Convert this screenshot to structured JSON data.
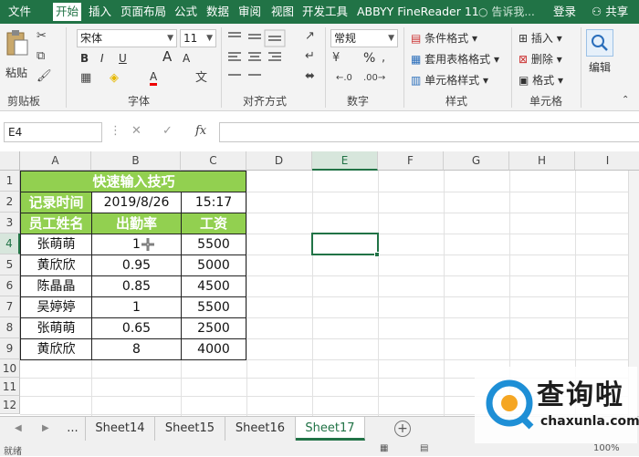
{
  "menubar": {
    "items": [
      "文件",
      "开始",
      "插入",
      "页面布局",
      "公式",
      "数据",
      "审阅",
      "视图",
      "开发工具",
      "ABBYY FineReader 11"
    ],
    "tell_me": "告诉我...",
    "login": "登录",
    "share": "共享"
  },
  "ribbon": {
    "clipboard": {
      "paste": "粘贴",
      "label": "剪贴板"
    },
    "font": {
      "name": "宋体",
      "size": "11",
      "label": "字体",
      "bold": "B",
      "italic": "I",
      "underline": "U",
      "grow": "A",
      "shrink": "A"
    },
    "alignment": {
      "label": "对齐方式"
    },
    "number": {
      "format": "常规",
      "label": "数字",
      "percent": "%"
    },
    "styles": {
      "conditional": "条件格式",
      "table": "套用表格格式",
      "cell_styles": "单元格样式",
      "label": "样式"
    },
    "cells": {
      "insert": "插入",
      "delete": "删除",
      "format": "格式",
      "label": "单元格"
    },
    "editing": {
      "label": "编辑"
    }
  },
  "formula_bar": {
    "name_box": "E4",
    "fx": "fx",
    "value": ""
  },
  "grid": {
    "columns": [
      "A",
      "B",
      "C",
      "D",
      "E",
      "F",
      "G",
      "H",
      "I"
    ],
    "rows": [
      "1",
      "2",
      "3",
      "4",
      "5",
      "6",
      "7",
      "8",
      "9",
      "10",
      "11",
      "12"
    ],
    "title": "快速输入技巧",
    "record_time_label": "记录时间",
    "date": "2019/8/26",
    "time": "15:17",
    "headers": [
      "员工姓名",
      "出勤率",
      "工资"
    ],
    "data": [
      [
        "张萌萌",
        "1",
        "5500"
      ],
      [
        "黄欣欣",
        "0.95",
        "5000"
      ],
      [
        "陈晶晶",
        "0.85",
        "4500"
      ],
      [
        "吴婷婷",
        "1",
        "5500"
      ],
      [
        "张萌萌",
        "0.65",
        "2500"
      ],
      [
        "黄欣欣",
        "8",
        "4000"
      ]
    ]
  },
  "tabs": {
    "ellipsis": "...",
    "sheets": [
      "Sheet14",
      "Sheet15",
      "Sheet16",
      "Sheet17"
    ],
    "active": "Sheet17"
  },
  "status": {
    "ready": "就绪",
    "zoom": "100%"
  },
  "watermark": {
    "text": "查询啦",
    "url": "chaxunla.com"
  },
  "colors": {
    "excel_green": "#217346",
    "cell_green": "#92d050"
  }
}
